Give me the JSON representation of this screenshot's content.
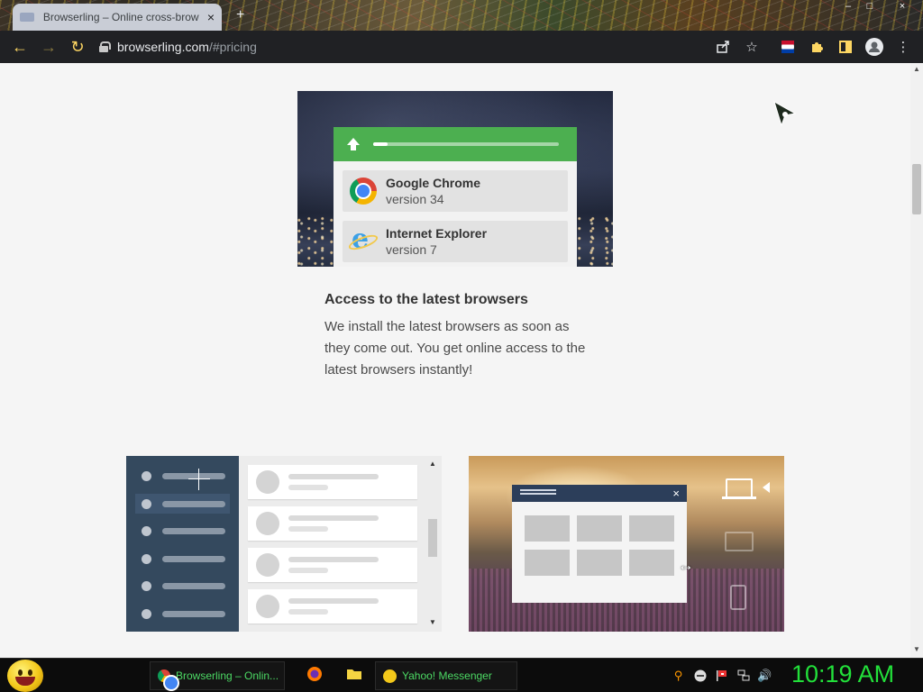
{
  "browser": {
    "tab_title": "Browserling – Online cross-brow",
    "tab_close": "×",
    "new_tab": "+",
    "url_host": "browserling.com",
    "url_path": "/#pricing",
    "window_controls": [
      "–",
      "□",
      "×"
    ]
  },
  "hero": {
    "upload_progress": 0.08,
    "browsers": [
      {
        "name": "Google Chrome",
        "version": "version 34",
        "icon": "chrome-icon"
      },
      {
        "name": "Internet Explorer",
        "version": "version 7",
        "icon": "internet-explorer-icon"
      }
    ]
  },
  "feature": {
    "title": "Access to the latest browsers",
    "text": "We install the latest browsers as soon as they come out. You get online access to the latest browsers instantly!"
  },
  "right_mock": {
    "close": "×"
  },
  "taskbar": {
    "tasks": [
      {
        "label": "Browserling – Onlin...",
        "icon": "chrome-icon"
      },
      {
        "label": "Yahoo! Messenger",
        "icon": "yahoo-messenger-icon"
      }
    ],
    "quick_launch": [
      "firefox-icon",
      "folder-icon"
    ],
    "tray_icons": [
      "search-icon",
      "messenger-status-icon",
      "flag-icon",
      "network-icon",
      "volume-icon"
    ],
    "clock": "10:19 AM"
  },
  "colors": {
    "accent_green": "#4caf50",
    "toolbar": "#202124",
    "clock": "#22e03a",
    "nav_icon": "#fdd663"
  }
}
